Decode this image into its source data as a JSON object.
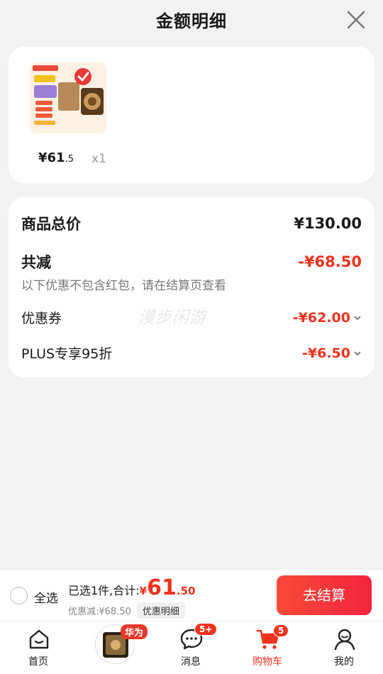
{
  "header": {
    "title": "金额明细"
  },
  "product": {
    "price_main": "¥61",
    "price_dec": ".5",
    "qty": "x1"
  },
  "summary": {
    "total_label": "商品总价",
    "total_value": "¥130.00",
    "reduce_label": "共减",
    "reduce_value": "-¥68.50",
    "reduce_note": "以下优惠不包含红包，请在结算页查看",
    "coupon_label": "优惠券",
    "coupon_value": "-¥62.00",
    "plus_label": "PLUS专享95折",
    "plus_value": "-¥6.50",
    "watermark": "漫步闲游"
  },
  "bottom_bar": {
    "select_all": "全选",
    "selected_text": "已选1件,合计:",
    "currency": "¥",
    "total_int": "61",
    "total_dec": ".50",
    "discount_text": "优惠减:¥68.50",
    "discount_detail": "优惠明细",
    "checkout": "去结算"
  },
  "tabbar": {
    "home": "首页",
    "promo_tag": "华为",
    "messages": "消息",
    "messages_badge": "5+",
    "cart": "购物车",
    "cart_badge": "5",
    "mine": "我的"
  },
  "colors": {
    "accent": "#f0321e",
    "checkout_start": "#f84a3a",
    "checkout_end": "#f3243c"
  }
}
